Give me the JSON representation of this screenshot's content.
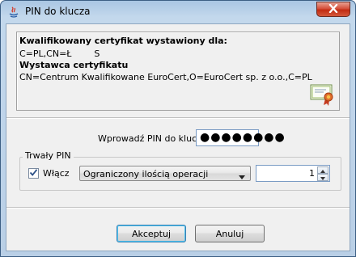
{
  "window": {
    "title": "PIN do klucza"
  },
  "certificate": {
    "issued_for_heading": "Kwalifikowany certyfikat wystawiony dla:",
    "subject": "C=PL,CN=Ł        S",
    "issuer_heading": "Wystawca certyfikatu",
    "issuer": "CN=Centrum Kwalifikowane EuroCert,O=EuroCert sp. z o.o.,C=PL"
  },
  "pin": {
    "label": "Wprowadź PIN do klucza",
    "value": "●●●●●●●●"
  },
  "lifetime": {
    "group_title": "Trwały PIN",
    "enable_label": "Włącz",
    "enabled": true,
    "mode_selected": "Ograniczony ilością operacji",
    "count_value": "1"
  },
  "buttons": {
    "accept_label": "Akceptuj",
    "cancel_label": "Anuluj"
  }
}
